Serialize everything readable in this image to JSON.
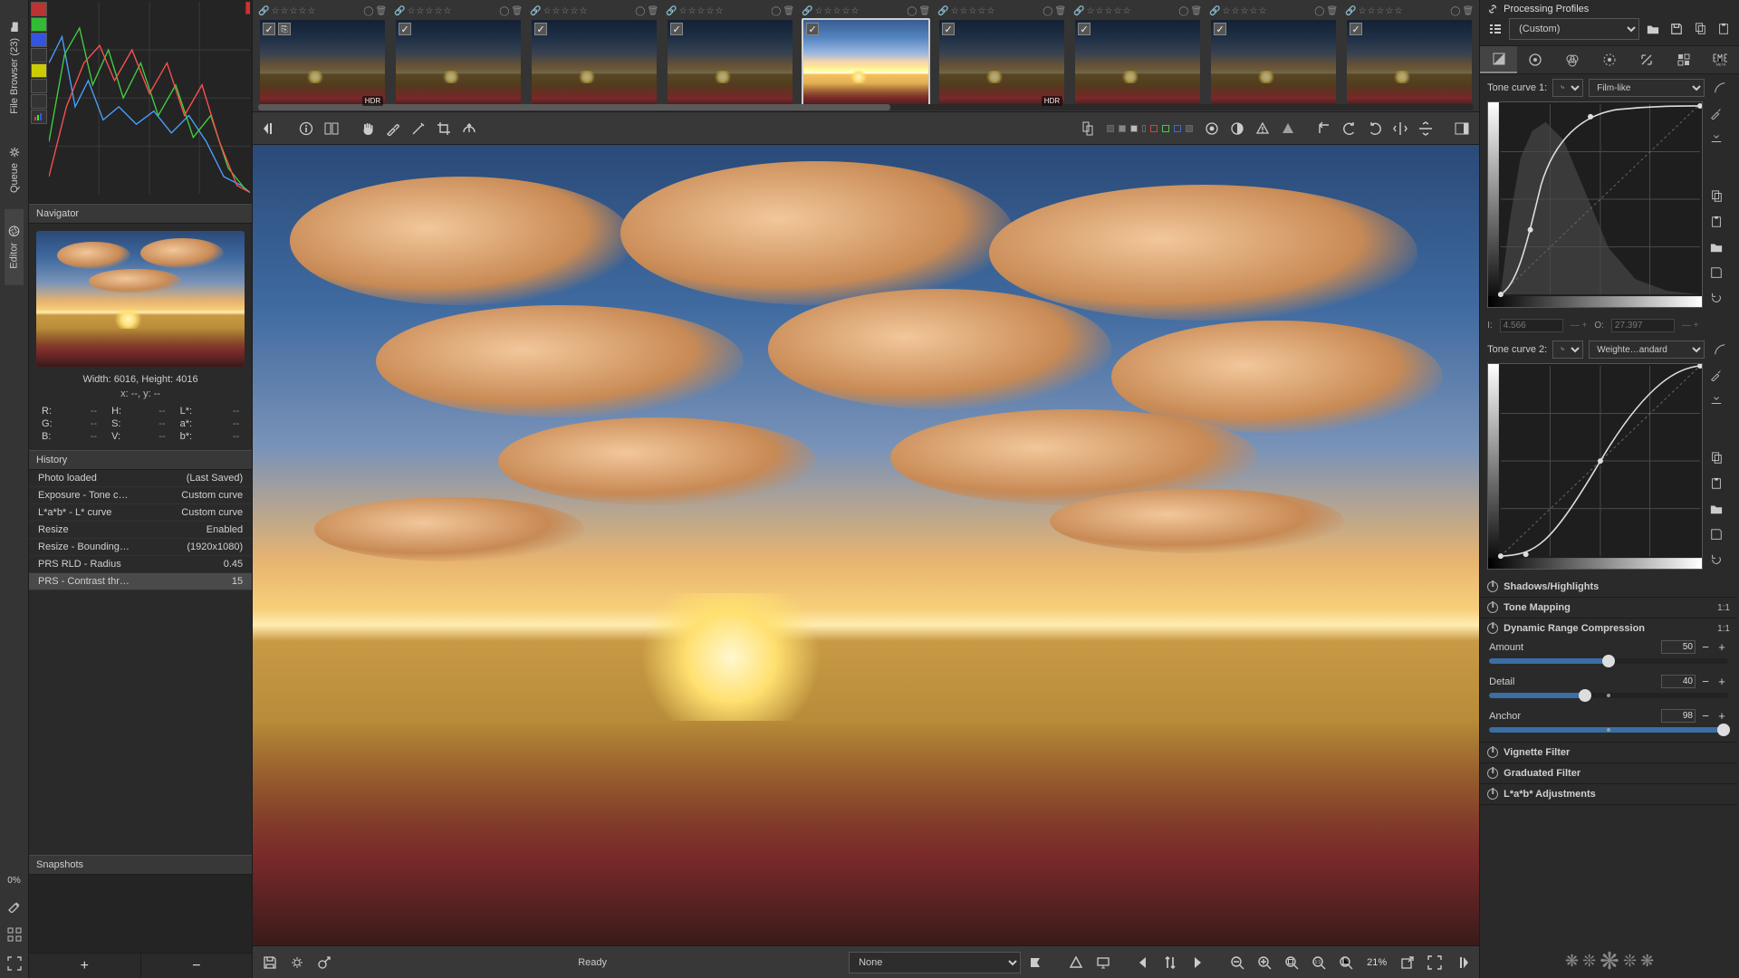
{
  "vtabs": {
    "file_browser": "File Browser (23)",
    "queue": "Queue",
    "editor": "Editor"
  },
  "zero_pc": "0%",
  "navigator": {
    "title": "Navigator",
    "dims": "Width: 6016, Height: 4016",
    "xy": "x: --, y: --",
    "labels": {
      "r": "R:",
      "g": "G:",
      "b": "B:",
      "h": "H:",
      "s": "S:",
      "v": "V:",
      "lstar": "L*:",
      "astar": "a*:",
      "bstar": "b*:"
    }
  },
  "history": {
    "title": "History",
    "rows": [
      {
        "l": "Photo loaded",
        "r": "(Last Saved)"
      },
      {
        "l": "Exposure - Tone c…",
        "r": "Custom curve"
      },
      {
        "l": "L*a*b* - L* curve",
        "r": "Custom curve"
      },
      {
        "l": "Resize",
        "r": "Enabled"
      },
      {
        "l": "Resize - Bounding…",
        "r": "(1920x1080)"
      },
      {
        "l": "PRS RLD - Radius",
        "r": "0.45"
      },
      {
        "l": "PRS - Contrast thr…",
        "r": "15"
      }
    ],
    "selected": 6
  },
  "snapshots": {
    "title": "Snapshots",
    "plus": "+",
    "minus": "−"
  },
  "filmstrip": {
    "thumbs": [
      {
        "hdr": true,
        "sel": false,
        "variant": "dark",
        "chk": true,
        "extra": true
      },
      {
        "hdr": false,
        "sel": false,
        "variant": "dark",
        "chk": true
      },
      {
        "hdr": false,
        "sel": false,
        "variant": "dark",
        "chk": true
      },
      {
        "hdr": false,
        "sel": false,
        "variant": "dark",
        "chk": true
      },
      {
        "hdr": false,
        "sel": true,
        "variant": "bright",
        "chk": true
      },
      {
        "hdr": true,
        "sel": false,
        "variant": "dark",
        "chk": true
      },
      {
        "hdr": false,
        "sel": false,
        "variant": "dark",
        "chk": true
      },
      {
        "hdr": false,
        "sel": false,
        "variant": "dark",
        "chk": true
      },
      {
        "hdr": false,
        "sel": false,
        "variant": "dark",
        "chk": true
      }
    ],
    "badge": "HDR",
    "stars": "☆☆☆☆☆"
  },
  "status": {
    "ready": "Ready",
    "intent": "None",
    "zoom": "21%"
  },
  "pp": {
    "title": "Processing Profiles",
    "current": "(Custom)"
  },
  "tooltabs": [
    "exposure",
    "detail",
    "color",
    "advanced",
    "transform",
    "raw",
    "meta"
  ],
  "curves": {
    "c1": {
      "label": "Tone curve 1:",
      "mode": "Film-like"
    },
    "c2": {
      "label": "Tone curve 2:",
      "mode": "Weighte…andard"
    },
    "io": {
      "i_lbl": "I:",
      "i_val": "4.566",
      "o_lbl": "O:",
      "o_val": "27.397"
    }
  },
  "sections": {
    "sh": "Shadows/Highlights",
    "tm": "Tone Mapping",
    "drc": "Dynamic Range Compression",
    "vig": "Vignette Filter",
    "grad": "Graduated Filter",
    "lab": "L*a*b* Adjustments",
    "oneone": "1:1"
  },
  "drc": {
    "amount": {
      "label": "Amount",
      "value": 50,
      "max": 100,
      "reset": 50
    },
    "detail": {
      "label": "Detail",
      "value": 40,
      "max": 100,
      "reset": 50
    },
    "anchor": {
      "label": "Anchor",
      "value": 98,
      "max": 100,
      "reset": 50
    }
  },
  "dash": "--"
}
